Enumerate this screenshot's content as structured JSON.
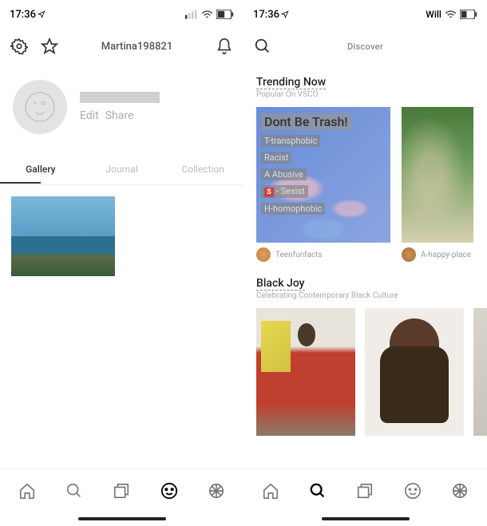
{
  "left": {
    "status": {
      "time": "17:36",
      "carrier": ""
    },
    "header": {
      "username": "Martina198821"
    },
    "profile": {
      "edit": "Edit",
      "share": "Share"
    },
    "tabs": {
      "gallery": "Gallery",
      "journal": "Journal",
      "collection": "Collection"
    }
  },
  "right": {
    "status": {
      "time": "17:36",
      "carrier": "Will"
    },
    "header": {
      "title": "Discover"
    },
    "trending": {
      "title": "Trending Now",
      "subtitle": "Popular On VSCO",
      "card1": {
        "line1": "Dont Be Trash!",
        "line2": "T-transphobic",
        "line3": "Racist",
        "line4": "A Abusive",
        "line5": "- Sexist",
        "line6": "H-homophobic",
        "author": "Teenfunfacts"
      },
      "card2": {
        "author": "A-happy-place"
      }
    },
    "blackjoy": {
      "title": "Black Joy",
      "subtitle": "Celebrating Contemporary Black Culture"
    }
  }
}
